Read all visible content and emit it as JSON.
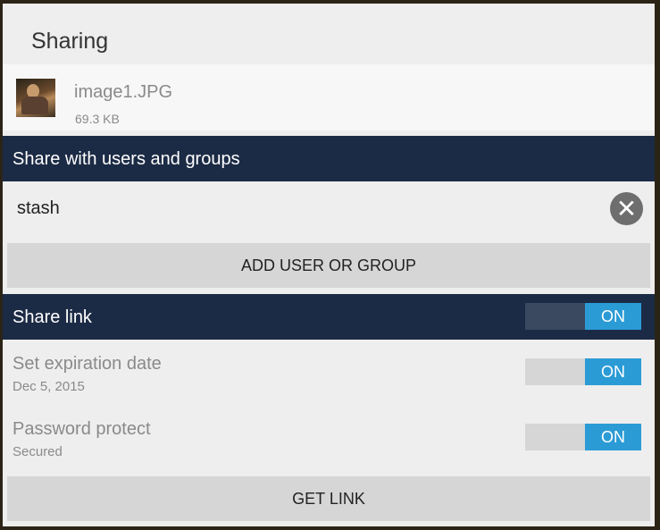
{
  "dialog": {
    "title": "Sharing"
  },
  "file": {
    "name": "image1.JPG",
    "size": "69.3 KB",
    "thumbnail_icon": "image-thumbnail"
  },
  "share_users": {
    "header": "Share with users and groups",
    "users": [
      {
        "name": "stash",
        "remove_icon": "close-icon"
      }
    ],
    "add_button": "ADD USER OR GROUP"
  },
  "share_link": {
    "header": "Share link",
    "toggle": "ON",
    "expiration": {
      "label": "Set expiration date",
      "value": "Dec 5, 2015",
      "toggle": "ON"
    },
    "password": {
      "label": "Password protect",
      "value": "Secured",
      "toggle": "ON"
    },
    "get_link_button": "GET LINK"
  },
  "colors": {
    "header_bg": "#1c2b45",
    "toggle_on": "#2b9bd6",
    "dialog_bg": "#eeeeee"
  }
}
